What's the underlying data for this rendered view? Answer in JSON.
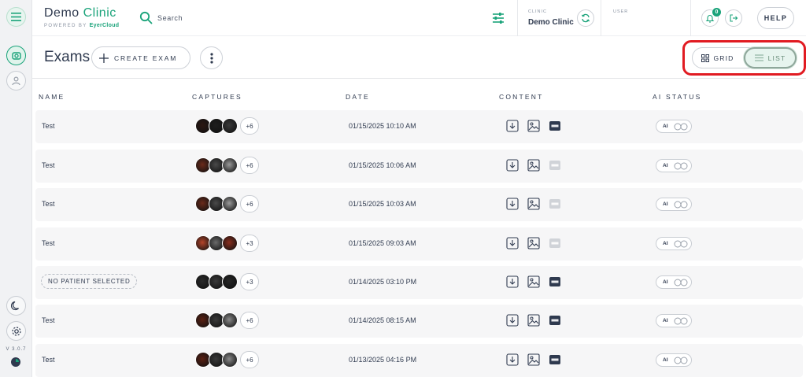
{
  "app": {
    "title_main": "Demo ",
    "title_accent": "Clinic",
    "powered_by": "POWERED BY",
    "powered_brand": "EyerCloud",
    "version": "V 3.0.7"
  },
  "header": {
    "search_placeholder": "Search",
    "clinic_label": "CLINIC",
    "clinic_value": "Demo Clinic",
    "user_label": "USER",
    "notification_count": "0",
    "help_label": "HELP"
  },
  "toolbar": {
    "page_title": "Exams",
    "create_label": "CREATE EXAM",
    "grid_label": "GRID",
    "list_label": "LIST"
  },
  "columns": [
    "NAME",
    "CAPTURES",
    "DATE",
    "CONTENT",
    "AI STATUS"
  ],
  "rows": [
    {
      "name": "Test",
      "is_chip": false,
      "captures_more": "+6",
      "date": "01/15/2025 10:10 AM",
      "pdf_available": true,
      "ai_label": "AI",
      "thumbs": [
        "#2b1712",
        "#1e1e1e",
        "#3a3a3a"
      ]
    },
    {
      "name": "Test",
      "is_chip": false,
      "captures_more": "+6",
      "date": "01/15/2025 10:06 AM",
      "pdf_available": false,
      "ai_label": "AI",
      "thumbs": [
        "#6a2a1a",
        "#4a4a4a",
        "#9a9a9a"
      ]
    },
    {
      "name": "Test",
      "is_chip": false,
      "captures_more": "+6",
      "date": "01/15/2025 10:03 AM",
      "pdf_available": false,
      "ai_label": "AI",
      "thumbs": [
        "#6a2a1a",
        "#4a4a4a",
        "#9a9a9a"
      ]
    },
    {
      "name": "Test",
      "is_chip": false,
      "captures_more": "+3",
      "date": "01/15/2025 09:03 AM",
      "pdf_available": false,
      "ai_label": "AI",
      "thumbs": [
        "#b5442a",
        "#6a6a6a",
        "#8a2e1e"
      ]
    },
    {
      "name": "NO PATIENT SELECTED",
      "is_chip": true,
      "captures_more": "+3",
      "date": "01/14/2025 03:10 PM",
      "pdf_available": true,
      "ai_label": "AI",
      "thumbs": [
        "#2a2a2a",
        "#3a3a3a",
        "#262626"
      ]
    },
    {
      "name": "Test",
      "is_chip": false,
      "captures_more": "+6",
      "date": "01/14/2025 08:15 AM",
      "pdf_available": true,
      "ai_label": "AI",
      "thumbs": [
        "#5a2012",
        "#3a3a3a",
        "#8a8a8a"
      ]
    },
    {
      "name": "Test",
      "is_chip": false,
      "captures_more": "+6",
      "date": "01/13/2025 04:16 PM",
      "pdf_available": true,
      "ai_label": "AI",
      "thumbs": [
        "#5a2012",
        "#3a3a3a",
        "#8a8a8a"
      ]
    }
  ],
  "colors": {
    "accent": "#1aa37a",
    "highlight": "#e11b22",
    "text": "#2f3a4f",
    "row_bg": "#f6f6f7"
  },
  "icons": [
    "menu-icon",
    "exams-icon",
    "patient-icon",
    "moon-icon",
    "gear-icon",
    "search-icon",
    "filter-icon",
    "sync-icon",
    "bell-icon",
    "logout-icon",
    "plus-icon",
    "more-vertical-icon",
    "grid-icon",
    "list-icon",
    "download-icon",
    "image-icon",
    "pdf-icon",
    "ai-toggle-icon"
  ]
}
